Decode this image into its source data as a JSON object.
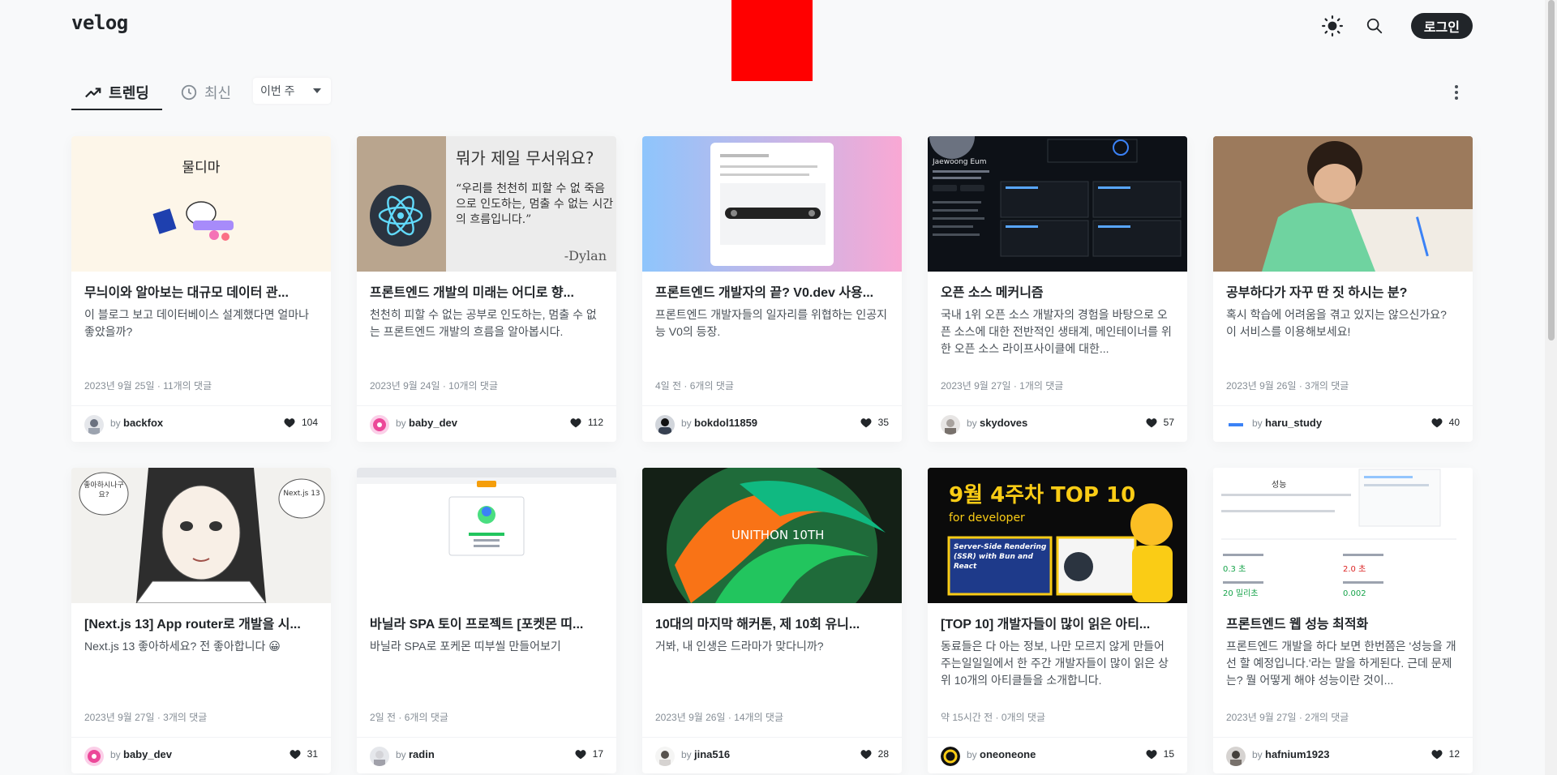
{
  "header": {
    "logo": "velog",
    "login_label": "로그인",
    "icons": [
      "sun-icon",
      "search-icon"
    ]
  },
  "tabs": {
    "trending_label": "트렌딩",
    "recent_label": "최신",
    "period_label": "이번 주"
  },
  "posts": [
    {
      "title": "무늬이와 알아보는 대규모 데이터 관...",
      "desc": "이 블로그 보고 데이터베이스 설계했다면 얼마나 좋았을까?",
      "meta": "2023년 9월 25일 · 11개의 댓글",
      "by": "by",
      "author": "backfox",
      "likes": "104",
      "thumb_text": "물디마"
    },
    {
      "title": "프론트엔드 개발의 미래는 어디로 향...",
      "desc": "천천히 피할 수 없는 공부로 인도하는, 멈출 수 없는 프론트엔드 개발의 흐름을 알아봅시다.",
      "meta": "2023년 9월 24일 · 10개의 댓글",
      "by": "by",
      "author": "baby_dev",
      "likes": "112",
      "thumb_text": "뭐가 제일 무서워요?",
      "thumb_quote": "“우리를 천천히 피할 수 없 죽음으로 인도하는, 멈출 수 없는 시간의 흐름입니다.”",
      "thumb_sign": "-Dylan"
    },
    {
      "title": "프론트엔드 개발자의 끝? V0.dev 사용...",
      "desc": "프론트엔드 개발자들의 일자리를 위협하는 인공지능 V0의 등장.",
      "meta": "4일 전 · 6개의 댓글",
      "by": "by",
      "author": "bokdol11859",
      "likes": "35"
    },
    {
      "title": "오픈 소스 메커니즘",
      "desc": "국내 1위 오픈 소스 개발자의 경험을 바탕으로 오픈 소스에 대한 전반적인 생태계, 메인테이너를 위한 오픈 소스 라이프사이클에 대한...",
      "meta": "2023년 9월 27일 · 1개의 댓글",
      "by": "by",
      "author": "skydoves",
      "likes": "57",
      "thumb_text": "Jaewoong Eum"
    },
    {
      "title": "공부하다가 자꾸 딴 짓 하시는 분?",
      "desc": "혹시 학습에 어려움을 겪고 있지는 않으신가요? 이 서비스를 이용해보세요!",
      "meta": "2023년 9월 26일 · 3개의 댓글",
      "by": "by",
      "author": "haru_study",
      "likes": "40"
    },
    {
      "title": "[Next.js 13] App router로 개발을 시...",
      "desc": "Next.js 13 좋아하세요? 전 좋아합니다 😀",
      "meta": "2023년 9월 27일 · 3개의 댓글",
      "by": "by",
      "author": "baby_dev",
      "likes": "31",
      "thumb_text": "좋아하시나구요?",
      "thumb_text2": "Next.js 13"
    },
    {
      "title": "바닐라 SPA 토이 프로젝트 [포켓몬 띠...",
      "desc": "바닐라 SPA로 포케몬 띠부씰 만들어보기",
      "meta": "2일 전 · 6개의 댓글",
      "by": "by",
      "author": "radin",
      "likes": "17"
    },
    {
      "title": "10대의 마지막 해커톤, 제 10회 유니...",
      "desc": "거봐, 내 인생은 드라마가 맞다니까?",
      "meta": "2023년 9월 26일 · 14개의 댓글",
      "by": "by",
      "author": "jina516",
      "likes": "28",
      "thumb_text": "UNITHON 10TH"
    },
    {
      "title": "[TOP 10] 개발자들이 많이 읽은 아티...",
      "desc": "동료들은 다 아는 정보, 나만 모르지 않게 만들어주는일일일에서 한 주간 개발자들이 많이 읽은 상위 10개의 아티클들을 소개합니다.",
      "meta": "약 15시간 전 · 0개의 댓글",
      "by": "by",
      "author": "oneoneone",
      "likes": "15",
      "thumb_text": "9월 4주차 TOP 10",
      "thumb_text2": "for developer",
      "thumb_text3": "Server-Side Rendering (SSR) with Bun and React"
    },
    {
      "title": "프론트엔드 웹 성능 최적화",
      "desc": "프론트엔드 개발을 하다 보면 한번쯤은 '성능을 개선 할 예정입니다.'라는 말을 하게된다. 근데 문제는? 뭘 어떻게 해야 성능이란 것이...",
      "meta": "2023년 9월 27일 · 2개의 댓글",
      "by": "by",
      "author": "hafnium1923",
      "likes": "12",
      "thumb_text": "성능",
      "thumb_m1": "0.3 초",
      "thumb_m2": "2.0 초",
      "thumb_m3": "20 밀리초",
      "thumb_m4": "0.002"
    }
  ]
}
